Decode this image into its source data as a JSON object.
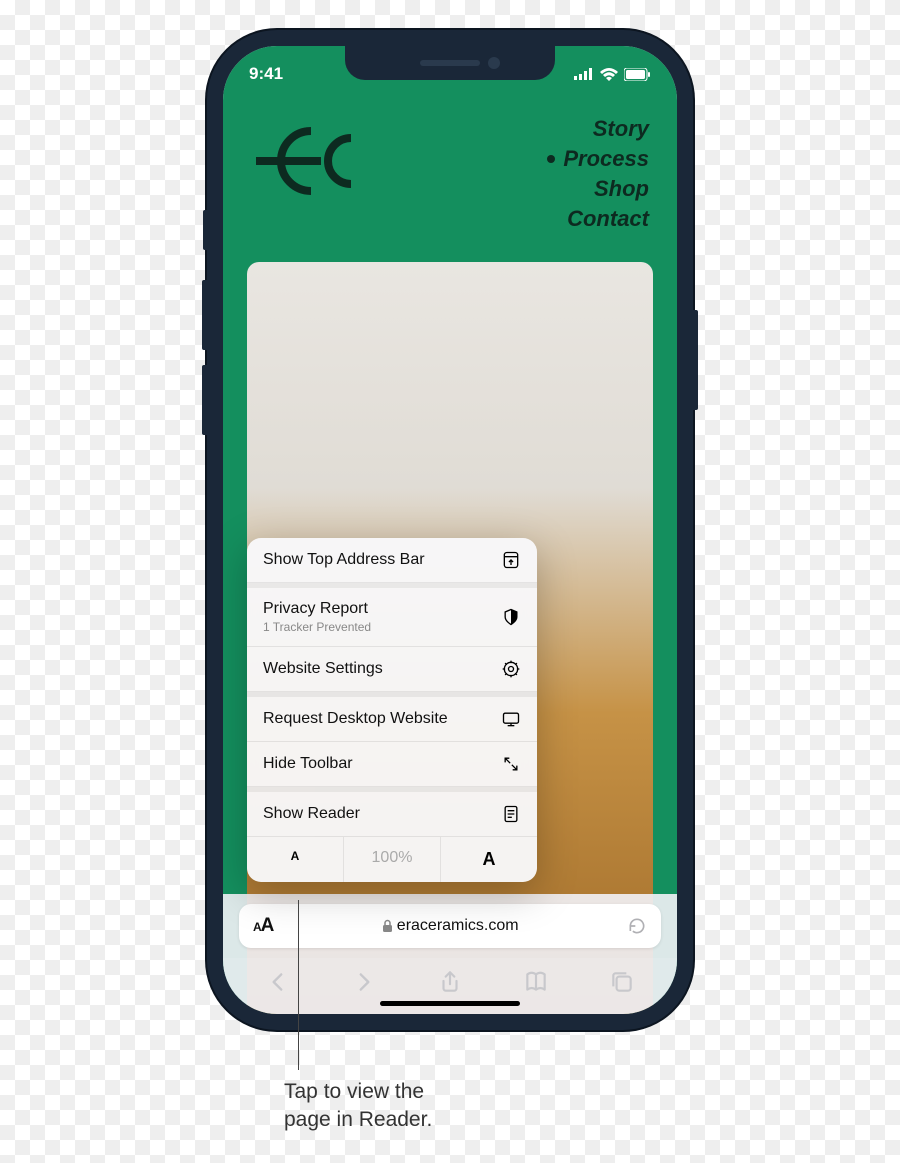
{
  "status": {
    "time": "9:41"
  },
  "site": {
    "nav": [
      "Story",
      "Process",
      "Shop",
      "Contact"
    ],
    "active": "Process"
  },
  "menu": {
    "show_top": "Show Top Address Bar",
    "privacy": "Privacy Report",
    "privacy_sub": "1 Tracker Prevented",
    "settings": "Website Settings",
    "desktop": "Request Desktop Website",
    "hide_toolbar": "Hide Toolbar",
    "show_reader": "Show Reader",
    "zoom": "100%"
  },
  "address": {
    "domain": "eraceramics.com"
  },
  "callout": {
    "line1": "Tap to view the",
    "line2": "page in Reader."
  }
}
